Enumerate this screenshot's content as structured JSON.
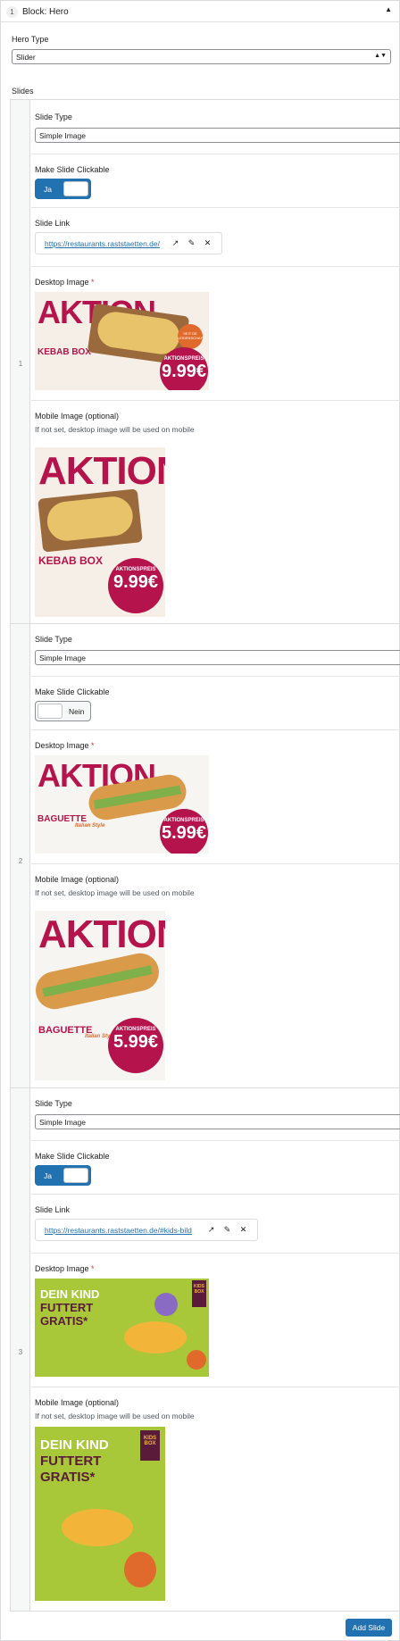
{
  "block": {
    "number": "1",
    "title": "Block: Hero",
    "collapse_icon": "caret-up-icon"
  },
  "hero_type": {
    "label": "Hero Type",
    "value": "Slider"
  },
  "slides_label": "Slides",
  "labels": {
    "slide_type": "Slide Type",
    "make_clickable": "Make Slide Clickable",
    "slide_link": "Slide Link",
    "desktop_image": "Desktop Image",
    "required_mark": "*",
    "mobile_image": "Mobile Image (optional)",
    "mobile_hint": "If not set, desktop image will be used on mobile"
  },
  "slides": [
    {
      "number": "1",
      "type": "Simple Image",
      "clickable": "Ja",
      "link": "https://restaurants.raststaetten.de/",
      "desktop": {
        "headline": "AKTION",
        "product": "KEBAB BOX",
        "badge_label": "AKTIONSPREIS",
        "price": "9.99€",
        "sticker": "SEIT DE LEIDENSCHAFT"
      },
      "mobile": {
        "headline": "AKTION",
        "product": "KEBAB BOX",
        "badge_label": "AKTIONSPREIS",
        "price": "9.99€"
      }
    },
    {
      "number": "2",
      "type": "Simple Image",
      "clickable": "Nein",
      "desktop": {
        "headline": "AKTION",
        "product": "BAGUETTE",
        "product_sub": "Italian Style",
        "badge_label": "AKTIONSPREIS",
        "price": "5.99€"
      },
      "mobile": {
        "headline": "AKTION",
        "product": "BAGUETTE",
        "product_sub": "Italian Style",
        "badge_label": "AKTIONSPREIS",
        "price": "5.99€"
      }
    },
    {
      "number": "3",
      "type": "Simple Image",
      "clickable": "Ja",
      "link": "https://restaurants.raststaetten.de/#kids-bild",
      "desktop": {
        "headline_1": "DEIN KIND",
        "headline_2": "FUTTERT",
        "headline_3": "GRATIS*",
        "box_label": "KIDS BOX"
      },
      "mobile": {
        "headline_1": "DEIN KIND",
        "headline_2": "FUTTERT",
        "headline_3": "GRATIS*",
        "box_label": "KIDS BOX"
      }
    }
  ],
  "add_button": "Add Slide",
  "colors": {
    "accent": "#2271b1",
    "promo_red": "#b5134b",
    "kids_green": "#a8c83a"
  }
}
